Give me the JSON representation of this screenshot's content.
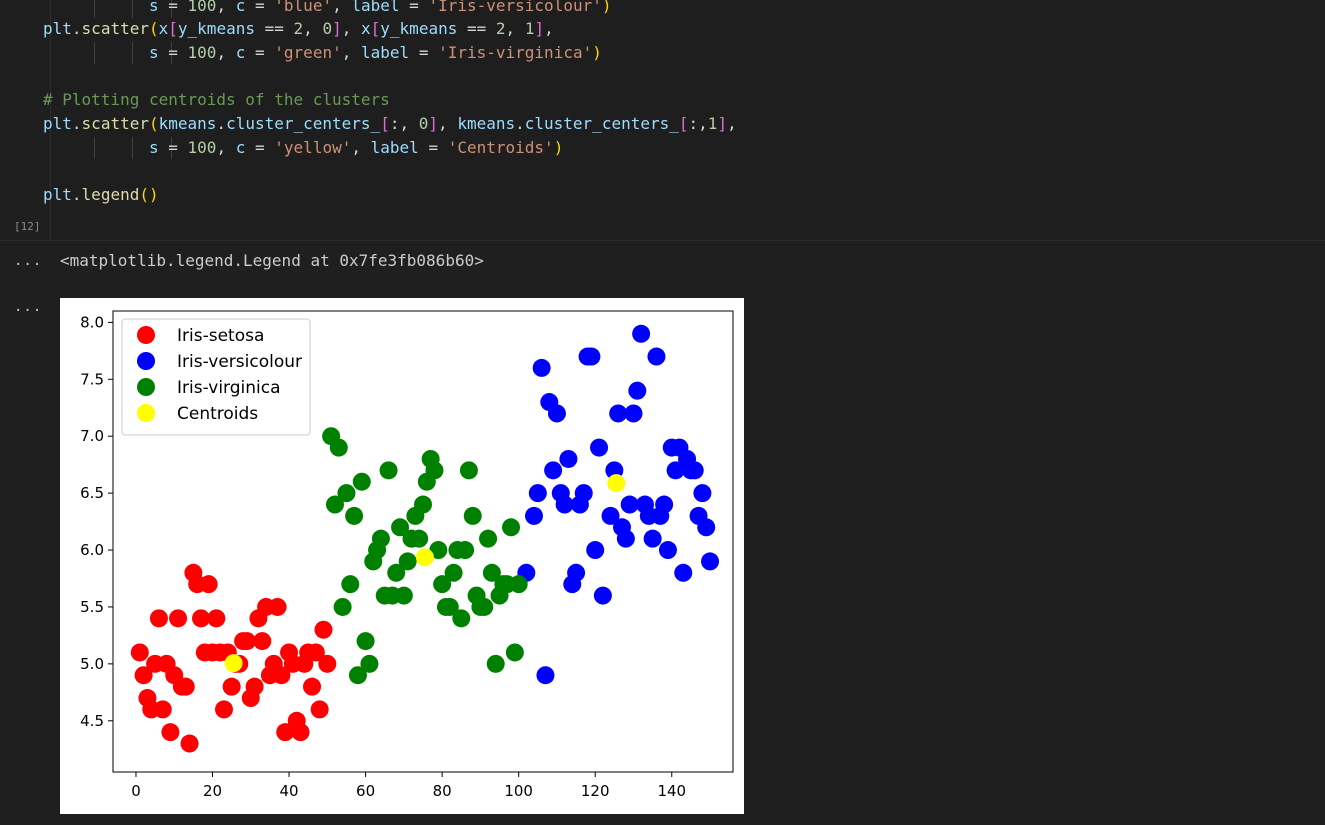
{
  "cell": {
    "execution_count": "[12]",
    "lines": [
      "           s = 100, c = 'blue', label = 'Iris-versicolour')",
      "plt.scatter(x[y_kmeans == 2, 0], x[y_kmeans == 2, 1],",
      "           s = 100, c = 'green', label = 'Iris-virginica')",
      "",
      "# Plotting centroids of the clusters",
      "plt.scatter(kmeans.cluster_centers_[:, 0], kmeans.cluster_centers_[:,1],",
      "           s = 100, c = 'yellow', label = 'Centroids')",
      "",
      "plt.legend()"
    ]
  },
  "output": {
    "more_icon_1": "...",
    "more_icon_2": "...",
    "text": "<matplotlib.legend.Legend at 0x7fe3fb086b60>"
  },
  "chart_data": {
    "type": "scatter",
    "xlim": [
      -6,
      156
    ],
    "ylim": [
      4.05,
      8.1
    ],
    "xticks": [
      0,
      20,
      40,
      60,
      80,
      100,
      120,
      140
    ],
    "yticks": [
      4.5,
      5.0,
      5.5,
      6.0,
      6.5,
      7.0,
      7.5,
      8.0
    ],
    "xtick_labels": [
      "0",
      "20",
      "40",
      "60",
      "80",
      "100",
      "120",
      "140"
    ],
    "ytick_labels": [
      "4.5",
      "5.0",
      "5.5",
      "6.0",
      "6.5",
      "7.0",
      "7.5",
      "8.0"
    ],
    "grid": false,
    "legend": "top-left",
    "series": [
      {
        "name": "Iris-setosa",
        "color": "#ff0000",
        "x": [
          1,
          2,
          3,
          4,
          5,
          6,
          7,
          8,
          9,
          10,
          11,
          12,
          13,
          14,
          15,
          16,
          17,
          18,
          19,
          20,
          21,
          22,
          23,
          24,
          25,
          26,
          27,
          28,
          29,
          30,
          31,
          32,
          33,
          34,
          35,
          36,
          37,
          38,
          39,
          40,
          41,
          42,
          43,
          44,
          45,
          46,
          47,
          48,
          49,
          50
        ],
        "y": [
          5.1,
          4.9,
          4.7,
          4.6,
          5.0,
          5.4,
          4.6,
          5.0,
          4.4,
          4.9,
          5.4,
          4.8,
          4.8,
          4.3,
          5.8,
          5.7,
          5.4,
          5.1,
          5.7,
          5.1,
          5.4,
          5.1,
          4.6,
          5.1,
          4.8,
          5.0,
          5.0,
          5.2,
          5.2,
          4.7,
          4.8,
          5.4,
          5.2,
          5.5,
          4.9,
          5.0,
          5.5,
          4.9,
          4.4,
          5.1,
          5.0,
          4.5,
          4.4,
          5.0,
          5.1,
          4.8,
          5.1,
          4.6,
          5.3,
          5.0
        ]
      },
      {
        "name": "Iris-versicolour",
        "color": "#0000ff",
        "x": [
          102,
          104,
          105,
          106,
          107,
          108,
          109,
          110,
          111,
          112,
          113,
          114,
          115,
          116,
          117,
          118,
          119,
          120,
          121,
          122,
          124,
          125,
          126,
          127,
          128,
          129,
          130,
          131,
          132,
          133,
          134,
          135,
          136,
          137,
          138,
          139,
          140,
          141,
          142,
          143,
          144,
          145,
          146,
          147,
          148,
          149,
          150
        ],
        "y": [
          5.8,
          6.3,
          6.5,
          7.6,
          4.9,
          7.3,
          6.7,
          7.2,
          6.5,
          6.4,
          6.8,
          5.7,
          5.8,
          6.4,
          6.5,
          7.7,
          7.7,
          6.0,
          6.9,
          5.6,
          6.3,
          6.7,
          7.2,
          6.2,
          6.1,
          6.4,
          7.2,
          7.4,
          7.9,
          6.4,
          6.3,
          6.1,
          7.7,
          6.3,
          6.4,
          6.0,
          6.9,
          6.7,
          6.9,
          5.8,
          6.8,
          6.7,
          6.7,
          6.3,
          6.5,
          6.2,
          5.9
        ]
      },
      {
        "name": "Iris-virginica",
        "color": "#008000",
        "x": [
          51,
          52,
          53,
          54,
          55,
          56,
          57,
          58,
          59,
          60,
          61,
          62,
          63,
          64,
          65,
          66,
          67,
          68,
          69,
          70,
          71,
          72,
          73,
          74,
          75,
          76,
          77,
          78,
          79,
          80,
          81,
          82,
          83,
          84,
          85,
          86,
          87,
          88,
          89,
          90,
          91,
          92,
          93,
          94,
          95,
          96,
          97,
          98,
          99,
          100
        ],
        "y": [
          7.0,
          6.4,
          6.9,
          5.5,
          6.5,
          5.7,
          6.3,
          4.9,
          6.6,
          5.2,
          5.0,
          5.9,
          6.0,
          6.1,
          5.6,
          6.7,
          5.6,
          5.8,
          6.2,
          5.6,
          5.9,
          6.1,
          6.3,
          6.1,
          6.4,
          6.6,
          6.8,
          6.7,
          6.0,
          5.7,
          5.5,
          5.5,
          5.8,
          6.0,
          5.4,
          6.0,
          6.7,
          6.3,
          5.6,
          5.5,
          5.5,
          6.1,
          5.8,
          5.0,
          5.6,
          5.7,
          5.7,
          6.2,
          5.1,
          5.7
        ]
      },
      {
        "name": "Centroids",
        "color": "#ffff00",
        "x": [
          25.5,
          75.5,
          125.5
        ],
        "y": [
          5.006,
          5.936,
          6.588
        ]
      }
    ]
  }
}
